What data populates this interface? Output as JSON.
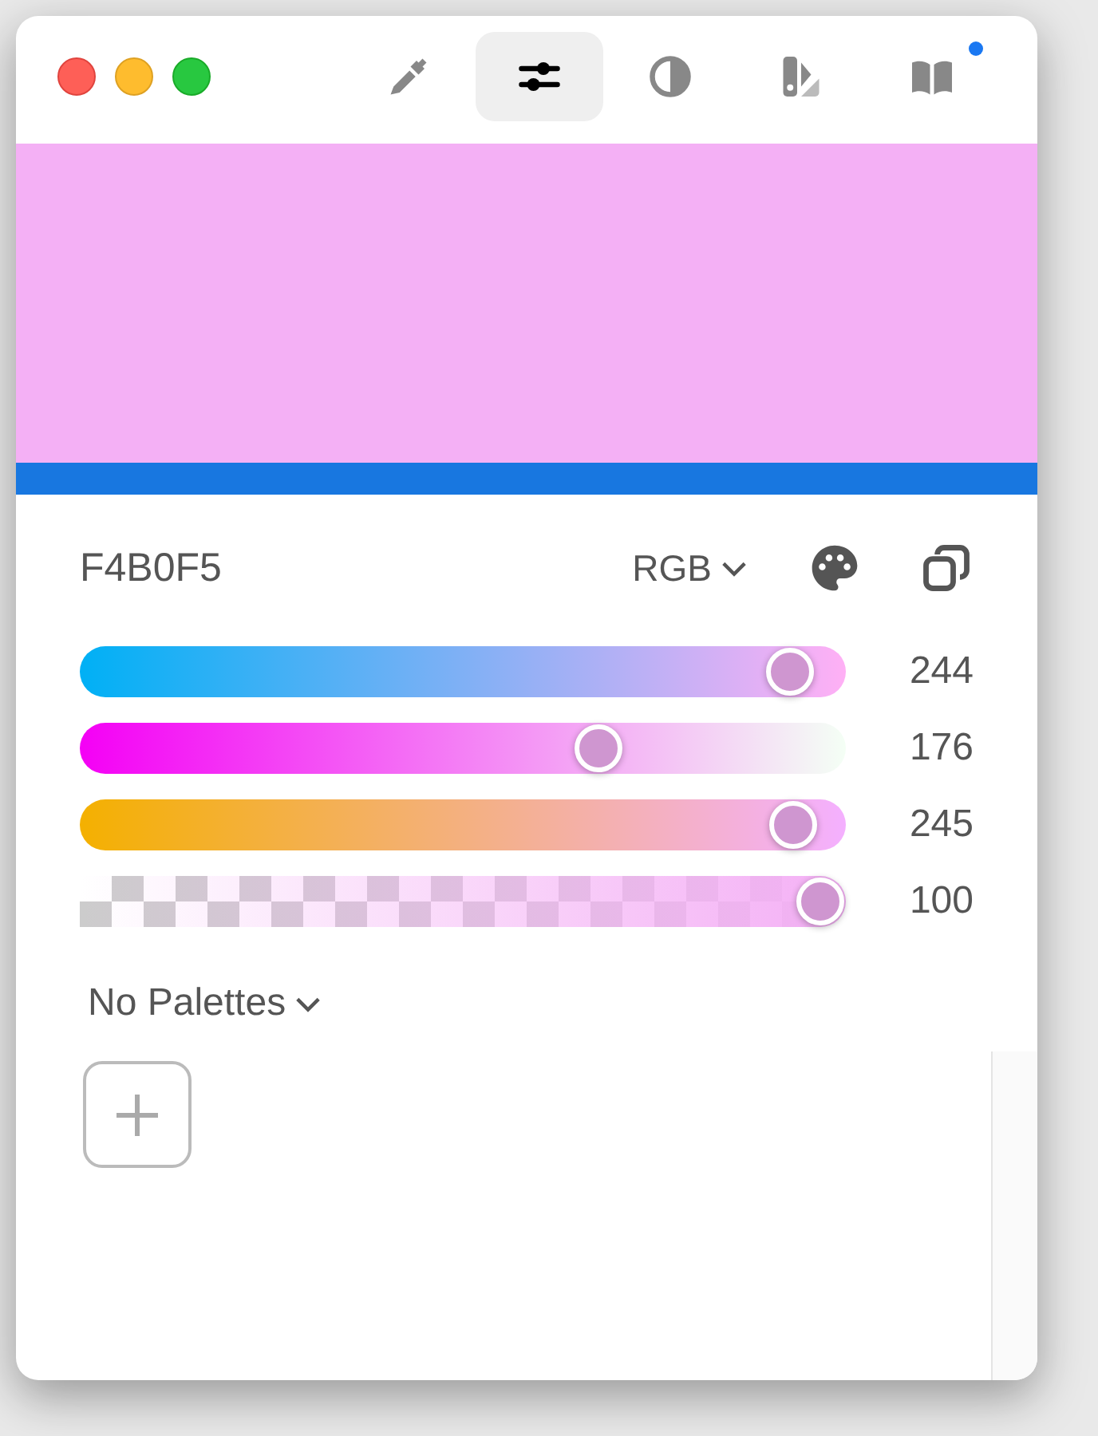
{
  "toolbar": {
    "tabs": [
      {
        "kind": "eyedropper",
        "selected": false,
        "dot": false
      },
      {
        "kind": "sliders",
        "selected": true,
        "dot": false
      },
      {
        "kind": "contrast",
        "selected": false,
        "dot": false
      },
      {
        "kind": "swatches",
        "selected": false,
        "dot": false
      },
      {
        "kind": "book",
        "selected": false,
        "dot": true
      }
    ]
  },
  "color": {
    "hex": "F4B0F5",
    "mode": "RGB"
  },
  "channels": [
    {
      "kind": "red",
      "level": 0.957,
      "reading": "244"
    },
    {
      "kind": "green",
      "level": 0.69,
      "reading": "176"
    },
    {
      "kind": "blue",
      "level": 0.961,
      "reading": "245"
    },
    {
      "kind": "alpha",
      "level": 1,
      "reading": "100"
    }
  ],
  "palettes": {
    "label": "No Palettes"
  }
}
